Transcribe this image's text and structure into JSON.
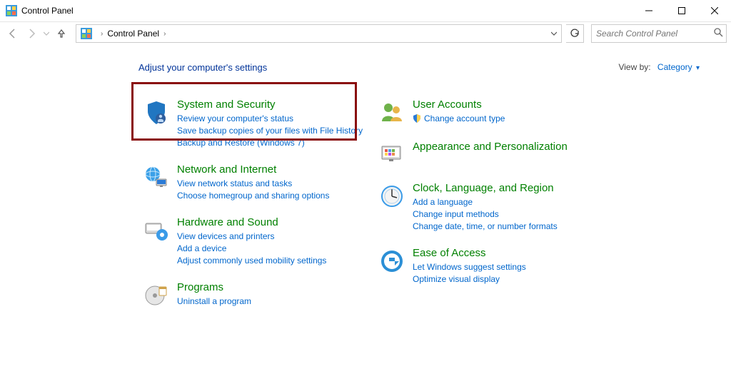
{
  "window": {
    "title": "Control Panel"
  },
  "address": {
    "root": "Control Panel"
  },
  "search": {
    "placeholder": "Search Control Panel"
  },
  "heading": "Adjust your computer's settings",
  "viewby": {
    "label": "View by:",
    "value": "Category"
  },
  "left": [
    {
      "title": "System and Security",
      "links": [
        "Review your computer's status",
        "Save backup copies of your files with File History",
        "Backup and Restore (Windows 7)"
      ]
    },
    {
      "title": "Network and Internet",
      "links": [
        "View network status and tasks",
        "Choose homegroup and sharing options"
      ]
    },
    {
      "title": "Hardware and Sound",
      "links": [
        "View devices and printers",
        "Add a device",
        "Adjust commonly used mobility settings"
      ]
    },
    {
      "title": "Programs",
      "links": [
        "Uninstall a program"
      ]
    }
  ],
  "right": [
    {
      "title": "User Accounts",
      "links": [
        "Change account type"
      ],
      "linkShield": [
        true
      ]
    },
    {
      "title": "Appearance and Personalization",
      "links": []
    },
    {
      "title": "Clock, Language, and Region",
      "links": [
        "Add a language",
        "Change input methods",
        "Change date, time, or number formats"
      ]
    },
    {
      "title": "Ease of Access",
      "links": [
        "Let Windows suggest settings",
        "Optimize visual display"
      ]
    }
  ]
}
